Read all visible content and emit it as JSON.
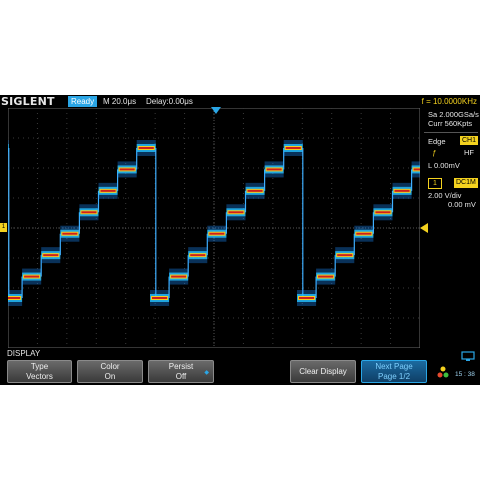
{
  "header": {
    "brand": "SIGLENT",
    "status": "Ready",
    "timebase": "M 20.0μs",
    "delay": "Delay:0.00μs",
    "frequency": "f = 10.0000KHz"
  },
  "side_panel": {
    "sample_rate": "Sa 2.000GSa/s",
    "memory_depth": "Curr 560Kpts",
    "trigger_type": "Edge",
    "trigger_source": "CH1",
    "trigger_coupling": "HF",
    "trigger_level": "L  0.00mV",
    "channel_number": "1",
    "channel_coupling": "DC1M",
    "volts_per_div": "2.00 V/div",
    "offset": "0.00 mV"
  },
  "menu": {
    "title": "DISPLAY",
    "buttons": [
      {
        "line1": "Type",
        "line2": "Vectors"
      },
      {
        "line1": "Color",
        "line2": "On"
      },
      {
        "line1": "Persist",
        "line2": "Off"
      },
      {
        "line1": "Clear Display",
        "line2": ""
      },
      {
        "line1": "Next Page",
        "line2": "Page 1/2"
      }
    ],
    "clock": "15 : 38"
  },
  "colors": {
    "accent": "#2aa6e6",
    "trigger": "#f4d21f",
    "trace_core": "#d0201a",
    "trace_glow": "#1a8cff"
  },
  "icons": [
    "trigger-position-marker",
    "trigger-level-marker",
    "channel-1-ground-marker",
    "network-icon",
    "usb-icon",
    "persist-adjust-icon"
  ],
  "waveform": {
    "type": "staircase-sawtooth",
    "steps_per_period": 8,
    "periods_visible": 2.8
  }
}
